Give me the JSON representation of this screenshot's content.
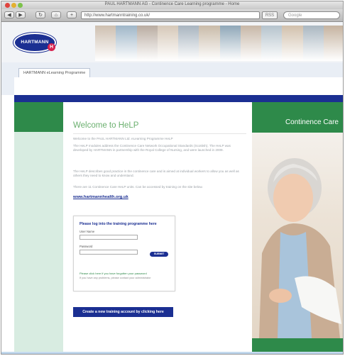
{
  "browser": {
    "window_title": "PAUL HARTMANN AG - Continence Care Learning programme - Home",
    "nav_back": "◀",
    "nav_forward": "▶",
    "nav_reload": "↻",
    "nav_home": "⌂",
    "nav_add": "+",
    "address": "http://www.hartmanntraining.co.uk/",
    "rss": "RSS",
    "search_placeholder": "Google"
  },
  "site": {
    "logo_text": "HARTMANN",
    "logo_mark": "H",
    "tab_label": "HARTMANN eLearning Programme",
    "photo_colors": [
      "#cdbfb0",
      "#9fb6c8",
      "#b9aca1",
      "#d6c8b8",
      "#a8b4bf",
      "#c9bba9",
      "#8fa7b8",
      "#c7b7a7",
      "#b5c3cc",
      "#d1c0ac",
      "#aab7c1",
      "#c5b3a0"
    ]
  },
  "content": {
    "welcome_heading": "Welcome to HeLP",
    "para1": "Welcome to the PAUL HARTMANN Ltd. eLearning Programme HeLP",
    "para2": "The HeLP modules address the Continence Care Network Occupational Standards (Scottish). The HeLP was developed by HARTMANN in partnership with the Royal College of Nursing, and were launched in 2009.",
    "para3": "The HeLP describes good practice in the continence care and is aimed at individual workers to allow you as well as others they need to know and understand.",
    "para4": "There are 11 Continence Care HeLP units. Can be accessed by training on the site below.",
    "link_text": "www.hartmannhealth.org.uk"
  },
  "login": {
    "title": "Please log into the training programme here",
    "username_label": "User Name",
    "username_value": "",
    "password_label": "Password",
    "password_value": "",
    "submit_label": "SUBMIT",
    "forgot_text": "Please click here if you have forgotten your password",
    "problems_text": "If you have any problems, please contact your administrator"
  },
  "create_account": "Create a new training account by clicking here",
  "sidebar": {
    "heading": "Continence Care"
  }
}
